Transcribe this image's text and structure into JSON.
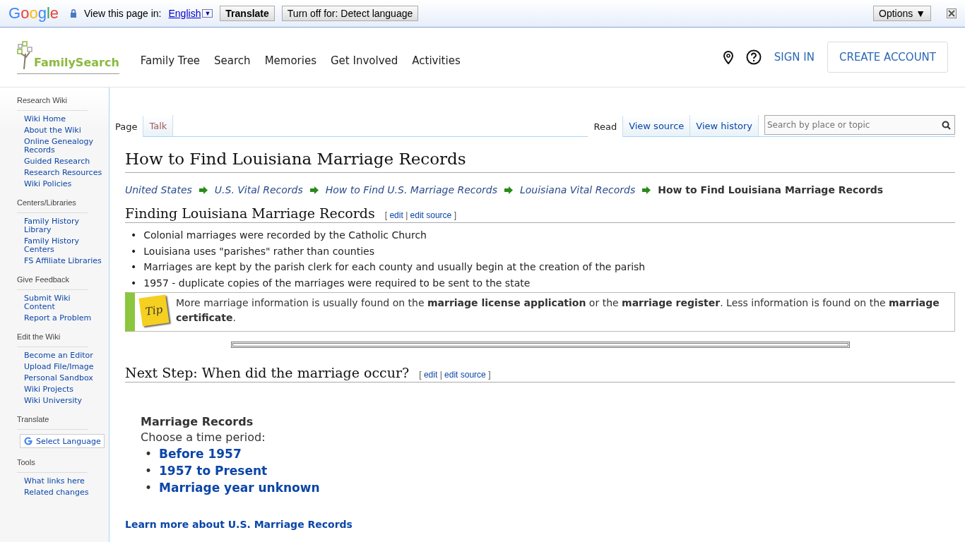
{
  "translate_bar": {
    "logo": "Google",
    "prompt": "View this page in:",
    "language": "English",
    "dropdown": "▼",
    "translate_button": "Translate",
    "turn_off_button": "Turn off for: Detect language",
    "options_button": "Options ▼"
  },
  "header": {
    "logo": "FamilySearch",
    "nav": [
      "Family Tree",
      "Search",
      "Memories",
      "Get Involved",
      "Activities"
    ],
    "sign_in": "SIGN IN",
    "create_account": "CREATE ACCOUNT"
  },
  "sidebar": [
    {
      "title": "Research Wiki",
      "items": [
        "Wiki Home",
        "About the Wiki",
        "Online Genealogy Records",
        "Guided Research",
        "Research Resources",
        "Wiki Policies"
      ]
    },
    {
      "title": "Centers/Libraries",
      "items": [
        "Family History Library",
        "Family History Centers",
        "FS Affiliate Libraries"
      ]
    },
    {
      "title": "Give Feedback",
      "items": [
        "Submit Wiki Content",
        "Report a Problem"
      ]
    },
    {
      "title": "Edit the Wiki",
      "items": [
        "Become an Editor",
        "Upload File/Image",
        "Personal Sandbox",
        "Wiki Projects",
        "Wiki University"
      ]
    },
    {
      "title": "Translate",
      "kind": "translate",
      "button": "Select Language"
    },
    {
      "title": "Tools",
      "items": [
        "What links here",
        "Related changes"
      ]
    }
  ],
  "left_tabs": [
    {
      "label": "Page",
      "selected": true,
      "missing": false
    },
    {
      "label": "Talk",
      "selected": false,
      "missing": true
    }
  ],
  "right_tabs": [
    {
      "label": "Read",
      "selected": true
    },
    {
      "label": "View source",
      "selected": false
    },
    {
      "label": "View history",
      "selected": false
    }
  ],
  "search": {
    "placeholder": "Search by place or topic"
  },
  "title": "How to Find Louisiana Marriage Records",
  "breadcrumb": {
    "links": [
      "United States",
      "U.S. Vital Records",
      "How to Find U.S. Marriage Records",
      "Louisiana Vital Records"
    ],
    "current": "How to Find Louisiana Marriage Records"
  },
  "section1": {
    "heading": "Finding Louisiana Marriage Records",
    "open": "[",
    "edit": "edit",
    "sep": "|",
    "edit_source": "edit source",
    "close": "]",
    "marker": "•",
    "bullets": [
      "Colonial marriages were recorded by the Catholic Church",
      "Louisiana uses \"parishes\" rather than counties",
      "Marriages are kept by the parish clerk for each county and usually begin at the creation of the parish",
      "1957 - duplicate copies of the marriages were required to be sent to the state"
    ],
    "tip": {
      "label": "Tip",
      "text": "More marriage information is usually found on the **marriage license application** or the **marriage register**. Less information is found on the **marriage certificate**."
    }
  },
  "section2": {
    "heading": "Next Step: When did the marriage occur?",
    "open": "[",
    "edit": "edit",
    "sep": "|",
    "edit_source": "edit source",
    "close": "]",
    "marker": "•",
    "box_title": "Marriage Records",
    "prompt": "Choose a time period:",
    "links": [
      "Before 1957",
      "1957 to Present",
      "Marriage year unknown"
    ]
  },
  "learn_more": "Learn more about U.S. Marriage Records"
}
